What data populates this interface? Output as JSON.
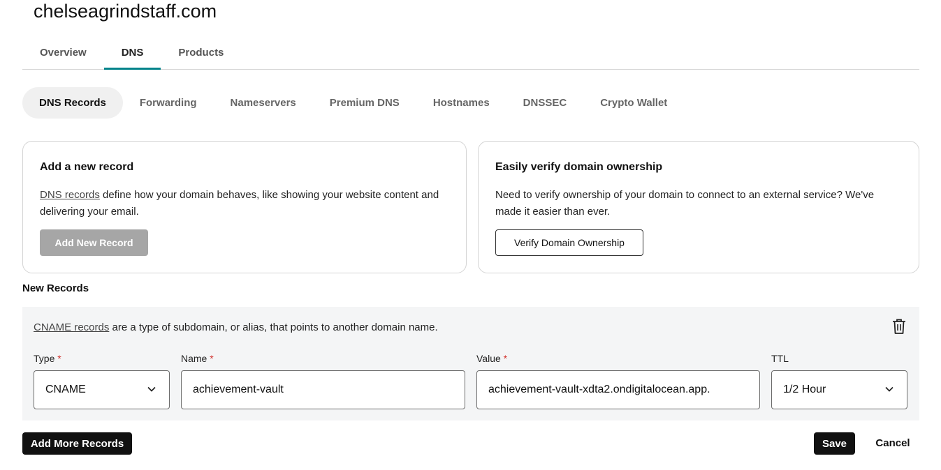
{
  "domain": "chelseagrindstaff.com",
  "main_tabs": [
    {
      "label": "Overview"
    },
    {
      "label": "DNS",
      "active": true
    },
    {
      "label": "Products"
    }
  ],
  "sub_tabs": [
    {
      "label": "DNS Records",
      "active": true
    },
    {
      "label": "Forwarding"
    },
    {
      "label": "Nameservers"
    },
    {
      "label": "Premium DNS"
    },
    {
      "label": "Hostnames"
    },
    {
      "label": "DNSSEC"
    },
    {
      "label": "Crypto Wallet"
    }
  ],
  "add_record_card": {
    "title": "Add a new record",
    "link_text": "DNS records",
    "description": " define how your domain behaves, like showing your website content and delivering your email.",
    "button_label": "Add New Record"
  },
  "verify_card": {
    "title": "Easily verify domain ownership",
    "description": "Need to verify ownership of your domain to connect to an external service? We've made it easier than ever.",
    "button_label": "Verify Domain Ownership"
  },
  "new_records": {
    "section_label": "New Records",
    "record": {
      "link_text": "CNAME records",
      "description": " are a type of subdomain, or alias, that points to another domain name.",
      "delete_icon": "trash-icon",
      "fields": {
        "type": {
          "label": "Type",
          "required": "*",
          "value": "CNAME"
        },
        "name": {
          "label": "Name",
          "required": "*",
          "value": "achievement-vault"
        },
        "value": {
          "label": "Value",
          "required": "*",
          "value": "achievement-vault-xdta2.ondigitalocean.app."
        },
        "ttl": {
          "label": "TTL",
          "value": "1/2 Hour"
        }
      }
    }
  },
  "actions": {
    "add_more": "Add More Records",
    "save": "Save",
    "cancel": "Cancel"
  },
  "colors": {
    "tab_accent": "#00838a",
    "required_asterisk": "#d2322d",
    "disabled_button": "#a6a6a6",
    "dark_button": "#111111",
    "panel_background": "#f4f5f6"
  }
}
